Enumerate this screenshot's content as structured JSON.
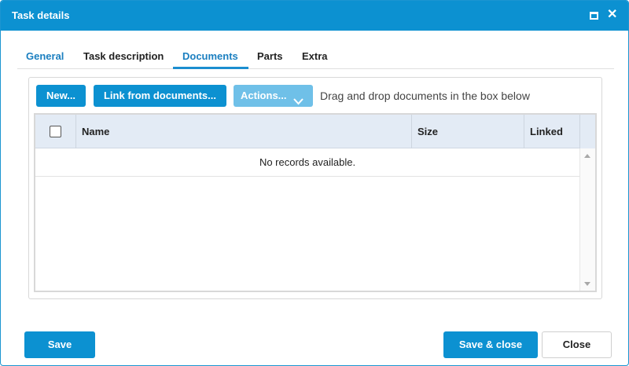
{
  "window": {
    "title": "Task details",
    "maximize_icon": "maximize-icon",
    "close_icon": "close-icon",
    "close_glyph": "✕"
  },
  "tabs": [
    {
      "label": "General",
      "active": false
    },
    {
      "label": "Task description",
      "active": false
    },
    {
      "label": "Documents",
      "active": true
    },
    {
      "label": "Parts",
      "active": false
    },
    {
      "label": "Extra",
      "active": false
    }
  ],
  "toolbar": {
    "new_label": "New...",
    "link_label": "Link from documents...",
    "actions_label": "Actions...",
    "actions_icon": "chevron-down-icon",
    "hint": "Drag and drop documents in the box below"
  },
  "grid": {
    "columns": [
      "Name",
      "Size",
      "Linked"
    ],
    "empty_message": "No records available."
  },
  "footer": {
    "save_label": "Save",
    "save_close_label": "Save & close",
    "close_label": "Close"
  },
  "colors": {
    "accent": "#0c91d1",
    "accent_disabled": "#6fc0e8",
    "header_bg": "#e3ebf5",
    "tab_link": "#1b7fc0"
  }
}
